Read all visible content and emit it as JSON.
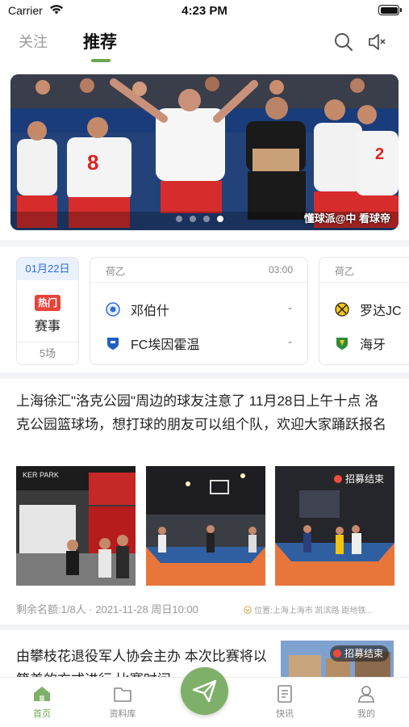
{
  "status_bar": {
    "carrier": "Carrier",
    "time": "4:23 PM"
  },
  "top_nav": {
    "tabs": [
      {
        "label": "关注",
        "active": false
      },
      {
        "label": "推荐",
        "active": true
      }
    ],
    "accent_color": "#6aa84f",
    "icons": [
      "search-icon",
      "speaker-icon"
    ]
  },
  "banner": {
    "caption": "懂球派@中 看球帝",
    "slide_count": 4,
    "active_slide": 4
  },
  "matches": {
    "date_card": {
      "date": "01月22日",
      "hot_badge": "热门",
      "label": "赛事",
      "count": "5场"
    },
    "items": [
      {
        "league": "荷乙",
        "time": "03:00",
        "home": {
          "name": "邓伯什",
          "score": "-"
        },
        "away": {
          "name": "FC埃因霍温",
          "score": "-"
        }
      },
      {
        "league": "荷乙",
        "time": "",
        "home": {
          "name": "罗达JC",
          "score": ""
        },
        "away": {
          "name": "海牙",
          "score": ""
        }
      }
    ]
  },
  "post1": {
    "title": "上海徐汇\"洛克公园\"周边的球友注意了 11月28日上午十点 洛克公园篮球场，想打球的朋友可以组个队，欢迎大家踊跃报名",
    "photo_badge": "招募结束",
    "meta": "剩余名额:1/8人 · 2021-11-28 周日10:00",
    "location": "位置:上海上海市 凯滨路 距地铁..."
  },
  "post2": {
    "title": "由攀枝花退役军人协会主办 本次比赛将以籍美的方式进行 比赛时间",
    "photo_badge": "招募结束"
  },
  "tab_bar": {
    "items": [
      {
        "label": "首页",
        "icon": "home-icon",
        "active": true
      },
      {
        "label": "资料库",
        "icon": "folder-icon",
        "active": false
      },
      {
        "label": "快讯",
        "icon": "news-icon",
        "active": false
      },
      {
        "label": "我的",
        "icon": "profile-icon",
        "active": false
      }
    ],
    "fab_icon": "send-icon"
  }
}
